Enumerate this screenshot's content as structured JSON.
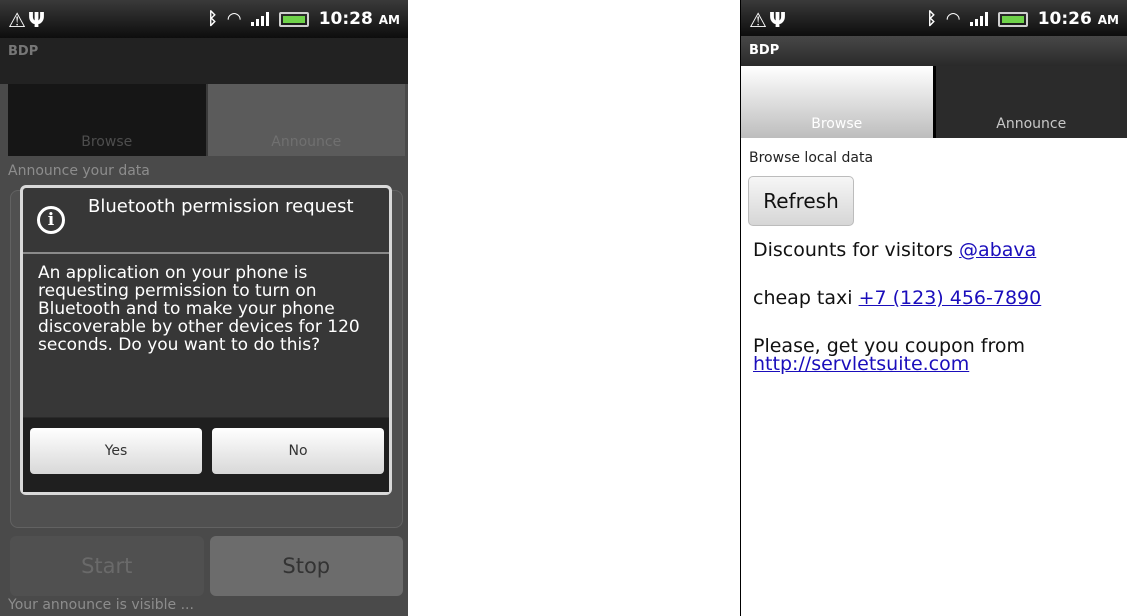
{
  "status_left": {
    "icons": [
      "warning-icon",
      "usb-icon"
    ],
    "time": "10:28",
    "ampm": "AM"
  },
  "status_right": {
    "icons": [
      "warning-icon",
      "usb-icon"
    ],
    "time": "10:26",
    "ampm": "AM"
  },
  "left": {
    "app_title": "BDP",
    "tabs": [
      "Browse",
      "Announce"
    ],
    "subtitle": "Announce your data",
    "start_label": "Start",
    "stop_label": "Stop",
    "footer": "Your announce is visible ...",
    "dialog": {
      "title": "Bluetooth permission request",
      "message": "An application on your phone is requesting permission to turn on Bluetooth and to make your phone discoverable by other devices for 120 seconds. Do you want to do this?",
      "yes_label": "Yes",
      "no_label": "No"
    }
  },
  "right": {
    "app_title": "BDP",
    "tabs": [
      "Browse",
      "Announce"
    ],
    "subtitle": "Browse local data",
    "refresh_label": "Refresh",
    "messages": [
      {
        "text": "Discounts for visitors ",
        "link": "@abava"
      },
      {
        "text": "cheap taxi ",
        "link": "+7 (123) 456-7890"
      },
      {
        "text": "Please, get you coupon from",
        "link": "http://servletsuite.com"
      }
    ]
  }
}
